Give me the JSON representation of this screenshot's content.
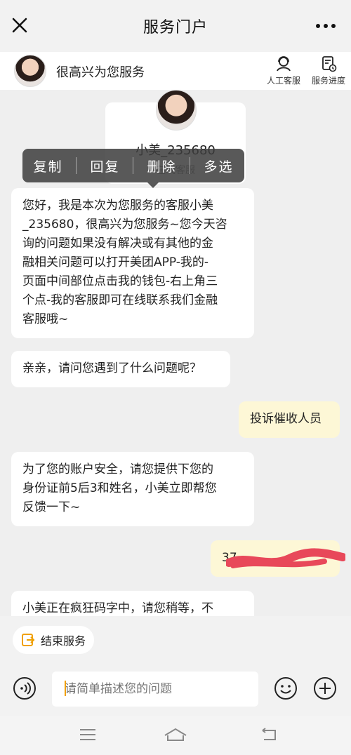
{
  "topbar": {
    "title": "服务门户",
    "close_icon": "close-icon",
    "more_icon": "more-icon"
  },
  "header": {
    "welcome": "很高兴为您服务",
    "agent_label": "人工客服",
    "progress_label": "服务进度"
  },
  "agent_card": {
    "name": "小美_235680",
    "role": "在线客服"
  },
  "context_menu": [
    "复制",
    "回复",
    "删除",
    "多选"
  ],
  "messages": [
    {
      "from": "agent",
      "lines": [
        "您好，我是本次为您服务的客服小美",
        "_235680，很高兴为您服务~您今天咨",
        "询的问题如果没有解决或有其他的金",
        "融相关问题可以打开美团APP-我的-",
        "页面中间部位点击我的钱包-右上角三",
        "个点-我的客服即可在线联系我们金融",
        "客服哦~"
      ]
    },
    {
      "from": "agent",
      "lines": [
        "亲亲，请问您遇到了什么问题呢？"
      ]
    },
    {
      "from": "user",
      "lines": [
        "投诉催收人员"
      ]
    },
    {
      "from": "agent",
      "lines": [
        "为了您的账户安全，请您提供下您的",
        "身份证前5后3和姓名，小美立即帮您",
        "反馈一下~"
      ]
    },
    {
      "from": "user",
      "lines": [
        "37"
      ]
    },
    {
      "from": "agent",
      "lines": [
        "小美正在疯狂码字中，请您稍等，不"
      ]
    }
  ],
  "end_service": "结束服务",
  "composer": {
    "placeholder": "请简单描述您的问题"
  },
  "colors": {
    "accent": "#f0a000",
    "user_bubble": "#fdf7d6",
    "redaction": "#e8485a"
  }
}
